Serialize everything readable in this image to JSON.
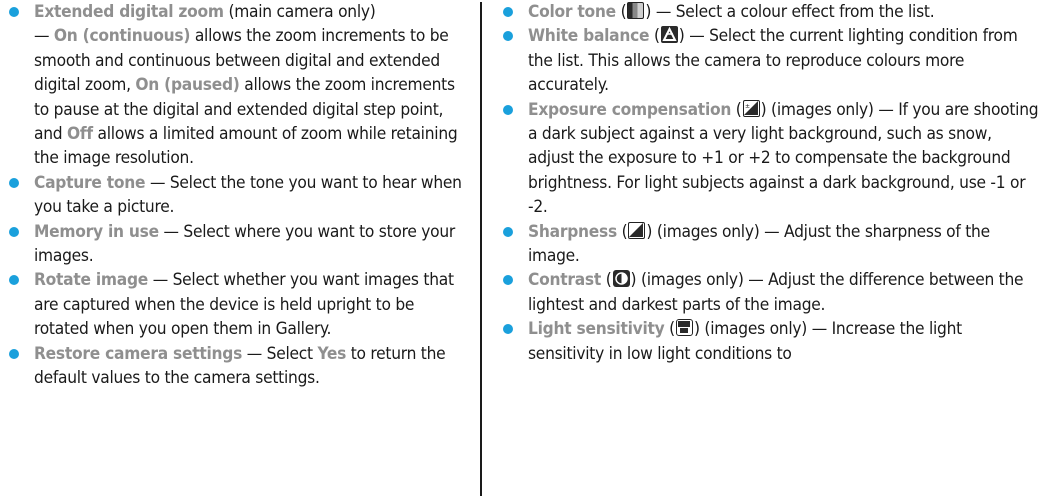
{
  "left": {
    "extended": {
      "term": "Extended digital zoom",
      "after_term": " (main camera only)",
      "dash1": " — ",
      "opt1": "On (continuous)",
      "text1": " allows the zoom increments to be smooth and continuous between digital and extended digital zoom, ",
      "opt2": "On (paused)",
      "text2": " allows the zoom increments to pause at the digital and extended digital step point, and ",
      "opt3": "Off",
      "text3": " allows a limited amount of zoom while retaining the image resolution."
    },
    "capture": {
      "term": "Capture tone",
      "text": "  — Select the tone you want to hear when you take a picture."
    },
    "memory": {
      "term": "Memory in use",
      "text": "  — Select where you want to store your images."
    },
    "rotate": {
      "term": "Rotate image",
      "text": "  — Select whether you want images that are captured when the device is held upright to be rotated when you open them in Gallery."
    },
    "restore": {
      "term": "Restore camera settings",
      "text1": " — Select ",
      "yes": "Yes",
      "text2": " to return the default values to the camera settings."
    }
  },
  "right": {
    "color": {
      "term": "Color tone",
      "open": " (",
      "close": ")",
      "text": "  — Select a colour effect from the list.",
      "icon": "color-tone-icon"
    },
    "wb": {
      "term": "White balance",
      "open": " (",
      "close": ")",
      "text": "  — Select the current lighting condition from the list. This allows the camera to reproduce colours more accurately.",
      "icon": "white-balance-icon"
    },
    "exposure": {
      "term": "Exposure compensation",
      "open": " (",
      "close": ")",
      "text": " (images only) — If you are shooting a dark subject against a very light background, such as snow, adjust the exposure to +1 or +2 to compensate the background brightness. For light subjects against a dark background, use -1 or -2.",
      "icon": "exposure-icon"
    },
    "sharp": {
      "term": "Sharpness",
      "open": " (",
      "close": ")",
      "text": " (images only)  — Adjust the sharpness of the image.",
      "icon": "sharpness-icon"
    },
    "contrast": {
      "term": "Contrast",
      "open": " (",
      "close": ")",
      "text": " (images only)  — Adjust the difference between the lightest and darkest parts of the image.",
      "icon": "contrast-icon"
    },
    "light": {
      "term": "Light sensitivity",
      "open": " (",
      "close": ")",
      "text": " (images only)  — Increase the light sensitivity in low light conditions to",
      "icon": "iso-icon"
    }
  },
  "colors": {
    "bullet": "#1aa0dc",
    "term": "#8f8f8f",
    "text": "#1a1a1a"
  }
}
